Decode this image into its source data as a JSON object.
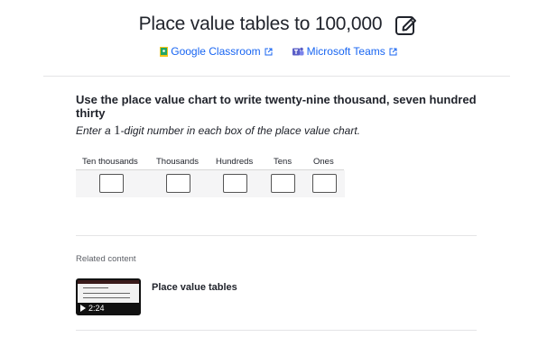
{
  "header": {
    "title": "Place value tables to 100,000",
    "edit_icon": "pencil-edit-icon"
  },
  "share": {
    "google_classroom": "Google Classroom",
    "microsoft_teams": "Microsoft Teams",
    "colors": {
      "link": "#1865f2",
      "gc_green": "#23a566",
      "gc_yellow": "#f5c518",
      "teams_purple": "#5b5fc7"
    }
  },
  "question": {
    "prompt": "Use the place value chart to write twenty-nine thousand, seven hundred thirty",
    "instruction_before": "Enter a ",
    "instruction_num": "1",
    "instruction_after": "-digit number in each box of the place value chart."
  },
  "chart": {
    "columns": [
      "Ten thousands",
      "Thousands",
      "Hundreds",
      "Tens",
      "Ones"
    ],
    "inputs": [
      "",
      "",
      "",
      "",
      ""
    ]
  },
  "related": {
    "label": "Related content",
    "items": [
      {
        "title": "Place value tables",
        "duration": "2:24",
        "type": "video"
      }
    ]
  }
}
